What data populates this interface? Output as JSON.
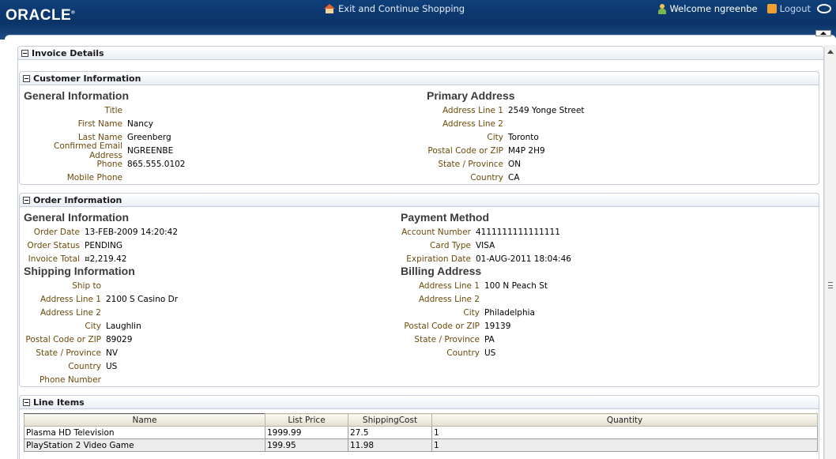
{
  "header": {
    "logo": "ORACLE",
    "exit_link": "Exit and Continue Shopping",
    "welcome": "Welcome ngreenbe",
    "logout": "Logout"
  },
  "invoice_panel": {
    "title": "Invoice Details"
  },
  "customer_panel": {
    "title": "Customer Information",
    "general": {
      "heading": "General Information",
      "fields": [
        {
          "label": "Title",
          "value": ""
        },
        {
          "label": "First Name",
          "value": "Nancy"
        },
        {
          "label": "Last Name",
          "value": "Greenberg"
        },
        {
          "label": "Confirmed Email Address",
          "value": "NGREENBE"
        },
        {
          "label": "Phone",
          "value": "865.555.0102"
        },
        {
          "label": "Mobile Phone",
          "value": ""
        }
      ]
    },
    "address": {
      "heading": "Primary Address",
      "fields": [
        {
          "label": "Address Line 1",
          "value": "2549 Yonge Street"
        },
        {
          "label": "Address Line 2",
          "value": ""
        },
        {
          "label": "City",
          "value": "Toronto"
        },
        {
          "label": "Postal Code or ZIP",
          "value": "M4P 2H9"
        },
        {
          "label": "State / Province",
          "value": "ON"
        },
        {
          "label": "Country",
          "value": "CA"
        }
      ]
    }
  },
  "order_panel": {
    "title": "Order Information",
    "general": {
      "heading": "General Information",
      "fields": [
        {
          "label": "Order Date",
          "value": "13-FEB-2009 14:20:42"
        },
        {
          "label": "Order Status",
          "value": "PENDING"
        },
        {
          "label": "Invoice Total",
          "value": "¤2,219.42"
        }
      ]
    },
    "payment": {
      "heading": "Payment Method",
      "fields": [
        {
          "label": "Account Number",
          "value": "4111111111111111"
        },
        {
          "label": "Card Type",
          "value": "VISA"
        },
        {
          "label": "Expiration Date",
          "value": "01-AUG-2011 18:04:46"
        }
      ]
    },
    "shipping": {
      "heading": "Shipping Information",
      "fields": [
        {
          "label": "Ship to",
          "value": ""
        },
        {
          "label": "Address Line 1",
          "value": "2100 S Casino Dr"
        },
        {
          "label": "Address Line 2",
          "value": ""
        },
        {
          "label": "City",
          "value": "Laughlin"
        },
        {
          "label": "Postal Code or ZIP",
          "value": "89029"
        },
        {
          "label": "State / Province",
          "value": "NV"
        },
        {
          "label": "Country",
          "value": "US"
        },
        {
          "label": "Phone Number",
          "value": ""
        }
      ]
    },
    "billing": {
      "heading": "Billing Address",
      "fields": [
        {
          "label": "Address Line 1",
          "value": "100 N Peach St"
        },
        {
          "label": "Address Line 2",
          "value": ""
        },
        {
          "label": "City",
          "value": "Philadelphia"
        },
        {
          "label": "Postal Code or ZIP",
          "value": "19139"
        },
        {
          "label": "State / Province",
          "value": "PA"
        },
        {
          "label": "Country",
          "value": "US"
        }
      ]
    }
  },
  "line_items_panel": {
    "title": "Line Items",
    "columns": [
      "Name",
      "List Price",
      "ShippingCost",
      "Quantity"
    ],
    "rows": [
      [
        "Plasma HD Television",
        "1999.99",
        "27.5",
        "1"
      ],
      [
        "PlayStation 2 Video Game",
        "199.95",
        "11.98",
        "1"
      ]
    ]
  }
}
